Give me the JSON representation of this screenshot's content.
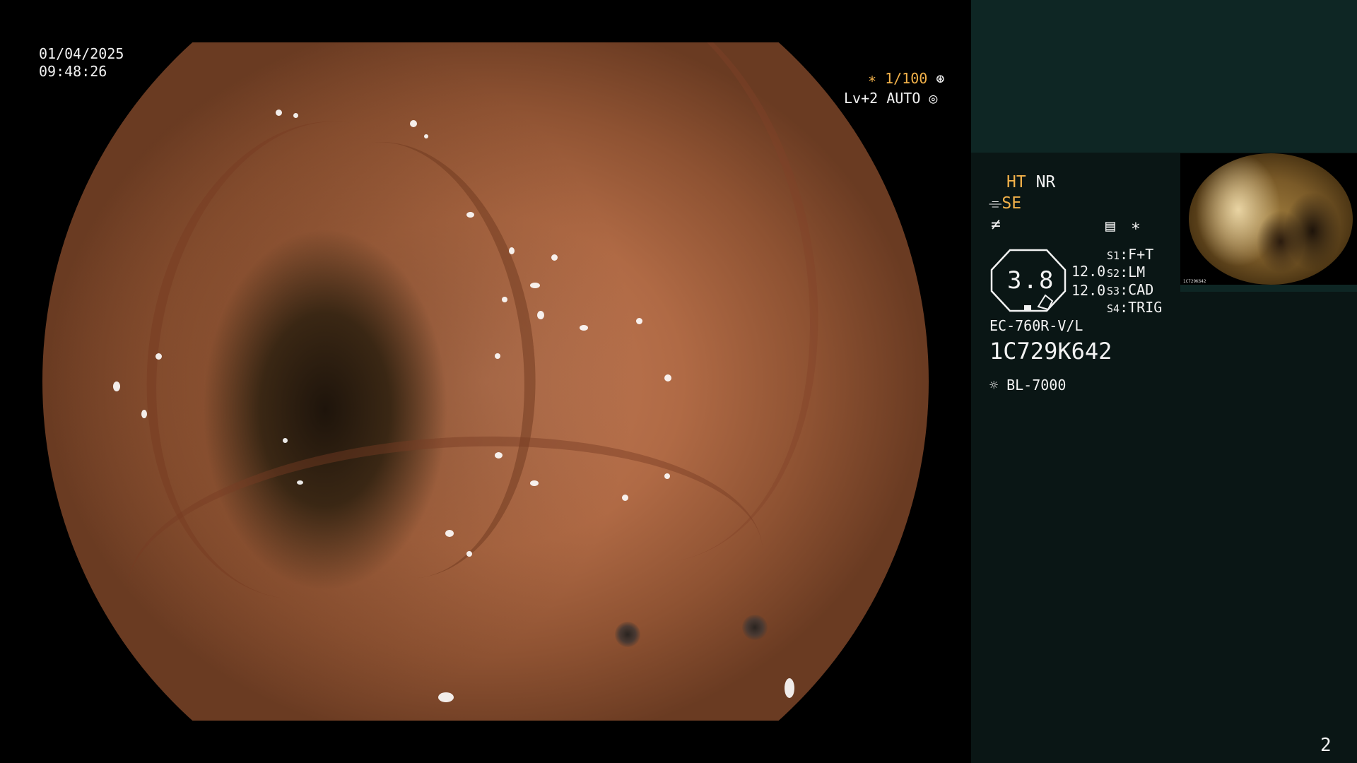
{
  "overlay": {
    "date": "01/04/2025",
    "time": "09:48:26",
    "shutter": "∗ 1/100",
    "level": "Lv+2 AUTO"
  },
  "panel": {
    "ht": "HT",
    "nr": "NR",
    "se": "SE",
    "dial_value": "3.8",
    "mag_top": "12.0",
    "mag_bottom": "12.0",
    "switches": [
      {
        "key": "S1",
        "value": "F+T"
      },
      {
        "key": "S2",
        "value": "LM"
      },
      {
        "key": "S3",
        "value": "CAD"
      },
      {
        "key": "S4",
        "value": "TRIG"
      }
    ],
    "scope_model": "EC-760R-V/L",
    "serial": "1C729K642",
    "light_source": "BL-7000",
    "page_number": "2"
  },
  "thumbnail": {
    "serial": "1C729K642"
  },
  "colors": {
    "accent": "#f3b24a",
    "panel_bg": "#0a1615",
    "panel_top_bg": "#0e2624"
  }
}
